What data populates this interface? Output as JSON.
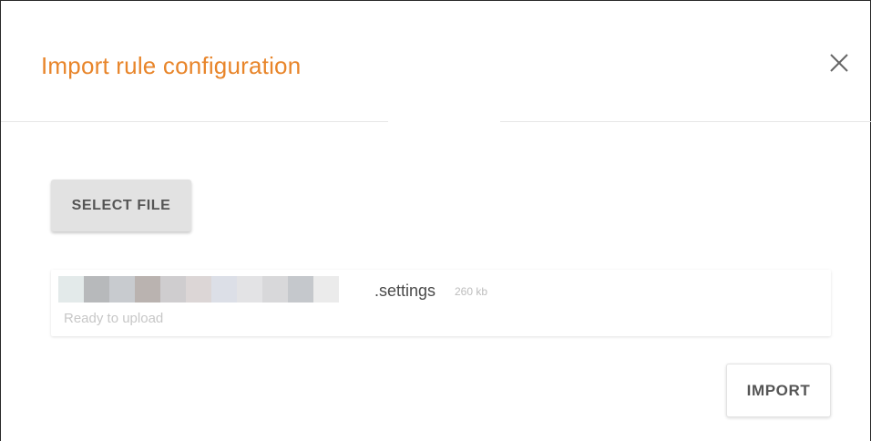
{
  "dialog": {
    "title": "Import rule configuration",
    "close_icon": "close-icon",
    "accent_color": "#e8852a"
  },
  "actions": {
    "select_file_label": "SELECT FILE",
    "import_label": "IMPORT"
  },
  "file": {
    "name_suffix": ".settings",
    "size": "260 kb",
    "status": "Ready to upload",
    "name_blurred": true
  }
}
